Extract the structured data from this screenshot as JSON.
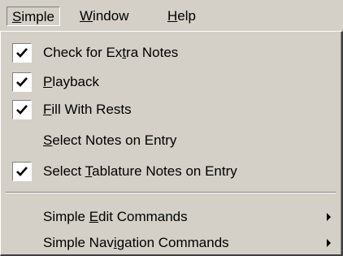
{
  "menubar": {
    "items": [
      {
        "label": "Simple",
        "mnemonic_index": 0,
        "active": true
      },
      {
        "label": "Window",
        "mnemonic_index": 0,
        "active": false
      },
      {
        "label": "Help",
        "mnemonic_index": 0,
        "active": false
      }
    ]
  },
  "menu": {
    "items": [
      {
        "label": "Check for Extra Notes",
        "mnemonic_index": 12,
        "checked": true,
        "submenu": false
      },
      {
        "label": "Playback",
        "mnemonic_index": 0,
        "checked": true,
        "submenu": false
      },
      {
        "label": "Fill With Rests",
        "mnemonic_index": 0,
        "checked": true,
        "submenu": false
      },
      {
        "label": "Select Notes on Entry",
        "mnemonic_index": 0,
        "checked": false,
        "submenu": false
      },
      {
        "label": "Select Tablature Notes on Entry",
        "mnemonic_index": 7,
        "checked": true,
        "submenu": false
      },
      {
        "label": "Simple Edit Commands",
        "mnemonic_index": 7,
        "checked": false,
        "submenu": true
      },
      {
        "label": "Simple Navigation Commands",
        "mnemonic_index": 10,
        "checked": false,
        "submenu": true
      }
    ],
    "icons": {
      "check": "checkmark-icon",
      "submenu": "submenu-arrow-icon"
    }
  }
}
